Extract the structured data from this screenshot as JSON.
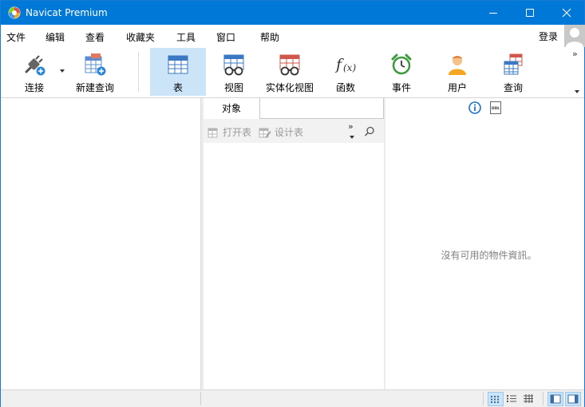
{
  "window": {
    "title": "Navicat Premium"
  },
  "menu": {
    "items": [
      "文件",
      "编辑",
      "查看",
      "收藏夹",
      "工具",
      "窗口",
      "帮助"
    ],
    "login": "登录"
  },
  "toolbar": {
    "connect": "连接",
    "new_query": "新建查询",
    "table": "表",
    "view": "视图",
    "materialized_view": "实体化视图",
    "function": "函数",
    "event": "事件",
    "user": "用户",
    "query": "查询"
  },
  "object_pane": {
    "tab_label": "对象",
    "search_value": "",
    "open_table": "打开表",
    "design_table": "设计表"
  },
  "info_pane": {
    "empty_message": "沒有可用的物件資訊。"
  },
  "colors": {
    "titlebar": "#0078d7",
    "active_tool": "#cce4f7",
    "status_bar": "#f0f0f0"
  },
  "icons": {
    "app": "navicat-logo-icon",
    "connect": "plug-icon",
    "new_query": "table-plus-icon",
    "table": "table-icon",
    "view": "glasses-table-icon",
    "materialized_view": "glasses-table-red-icon",
    "function": "fx-icon",
    "event": "alarm-clock-icon",
    "user": "user-icon",
    "query": "query-table-icon"
  }
}
